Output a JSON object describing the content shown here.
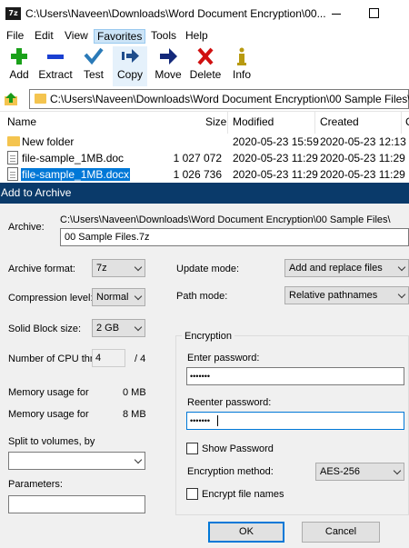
{
  "window": {
    "app_icon_text": "7z",
    "title": "C:\\Users\\Naveen\\Downloads\\Word Document Encryption\\00..."
  },
  "menu": [
    "File",
    "Edit",
    "View",
    "Favorites",
    "Tools",
    "Help"
  ],
  "toolbar": [
    {
      "label": "Add",
      "icon": "plus-icon",
      "color": "#1aa11a"
    },
    {
      "label": "Extract",
      "icon": "minus-icon",
      "color": "#1a3fd1"
    },
    {
      "label": "Test",
      "icon": "check-icon",
      "color": "#2a7ab8"
    },
    {
      "label": "Copy",
      "icon": "copy-arrow-icon",
      "color": "#1e4d8c"
    },
    {
      "label": "Move",
      "icon": "move-arrow-icon",
      "color": "#14297a"
    },
    {
      "label": "Delete",
      "icon": "x-icon",
      "color": "#d01010"
    },
    {
      "label": "Info",
      "icon": "info-icon",
      "color": "#b89a10"
    }
  ],
  "address": {
    "path": "C:\\Users\\Naveen\\Downloads\\Word Document Encryption\\00 Sample Files\\"
  },
  "file_list": {
    "columns": [
      "Name",
      "Size",
      "Modified",
      "Created",
      "C"
    ],
    "rows": [
      {
        "name": "New folder",
        "size": "",
        "modified": "2020-05-23 15:59",
        "created": "2020-05-23 12:13",
        "type": "folder"
      },
      {
        "name": "file-sample_1MB.doc",
        "size": "1 027 072",
        "modified": "2020-05-23 11:29",
        "created": "2020-05-23 11:29",
        "type": "doc"
      },
      {
        "name": "file-sample_1MB.docx",
        "size": "1 026 736",
        "modified": "2020-05-23 11:29",
        "created": "2020-05-23 11:29",
        "type": "doc",
        "selected": true
      }
    ]
  },
  "dialog": {
    "title": "Add to Archive",
    "archive_label": "Archive:",
    "archive_dir": "C:\\Users\\Naveen\\Downloads\\Word Document Encryption\\00 Sample Files\\",
    "archive_name": "00 Sample Files.7z",
    "archive_format_label": "Archive format:",
    "archive_format": "7z",
    "compression_level_label": "Compression level:",
    "compression_level": "Normal",
    "solid_block_label": "Solid Block size:",
    "solid_block": "2 GB",
    "cpu_threads_label": "Number of CPU thr",
    "cpu_threads": "4",
    "cpu_threads_max": "/ 4",
    "mem_compress_label": "Memory usage for",
    "mem_compress": "0 MB",
    "mem_decompress_label": "Memory usage for",
    "mem_decompress": "8 MB",
    "split_label": "Split to volumes, by",
    "split_value": "",
    "parameters_label": "Parameters:",
    "parameters_value": "",
    "update_mode_label": "Update mode:",
    "update_mode": "Add and replace files",
    "path_mode_label": "Path mode:",
    "path_mode": "Relative pathnames",
    "encryption": {
      "group_label": "Encryption",
      "enter_password_label": "Enter password:",
      "enter_password": "•••••••",
      "reenter_password_label": "Reenter password:",
      "reenter_password": "•••••••",
      "show_password_label": "Show Password",
      "show_password": false,
      "method_label": "Encryption method:",
      "method": "AES-256",
      "encrypt_names_label": "Encrypt file names",
      "encrypt_names": false
    },
    "ok_label": "OK",
    "cancel_label": "Cancel"
  }
}
